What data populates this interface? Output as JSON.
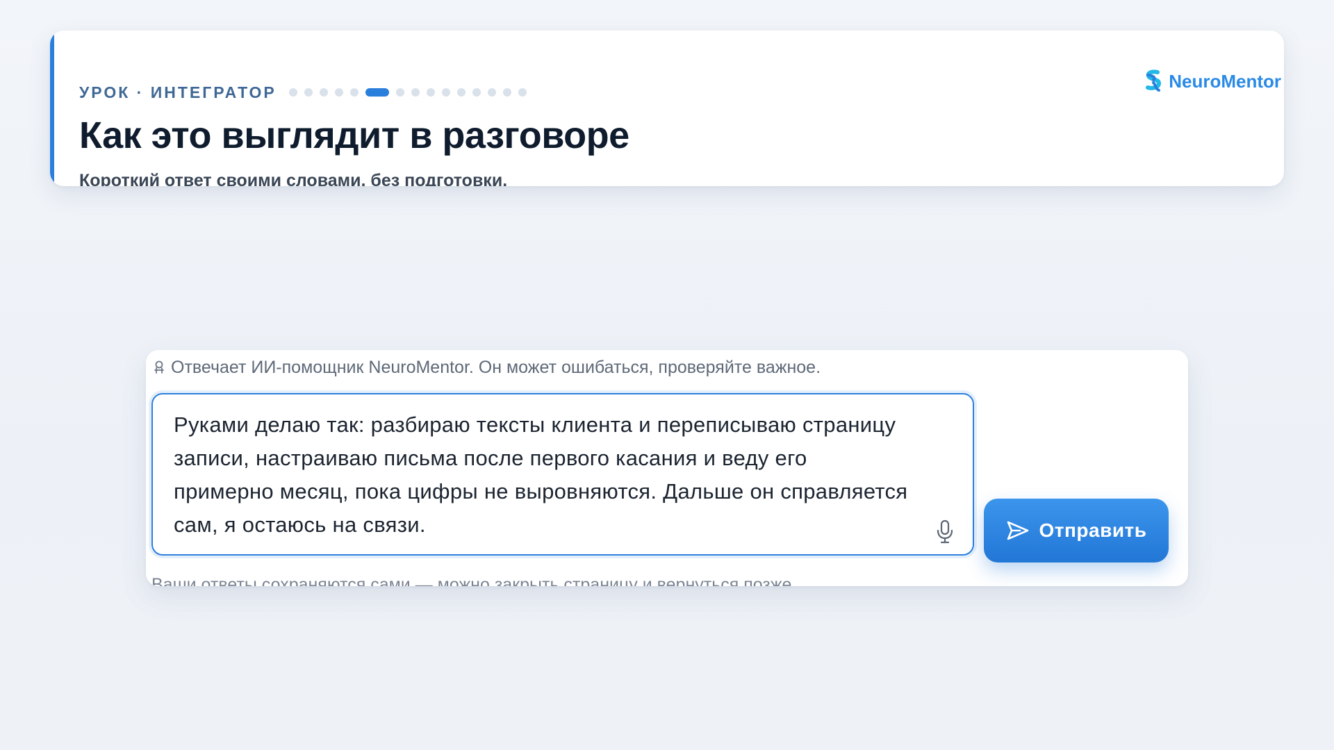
{
  "header": {
    "eyebrow": "УРОК · ИНТЕГРАТОР",
    "progress": {
      "total_steps": 15,
      "current_step": 6
    },
    "title": "Как это выглядит в разговоре",
    "subtitle": "Короткий ответ своими словами, без подготовки.",
    "brand": {
      "name": "NeuroMentor",
      "icon": "neuromentor-logo-icon",
      "color": "#2a8ae6"
    }
  },
  "composer": {
    "disclaimer_icon": "ai-assistant-icon",
    "disclaimer": "Отвечает ИИ-помощник NeuroMentor. Он может ошибаться, проверяйте важное.",
    "answer_value": "Руками делаю так: разбираю тексты клиента и переписываю страницу записи, настраиваю письма после первого касания и веду его примерно месяц, пока цифры не выровняются. Дальше он справляется сам, я остаюсь на связи.",
    "mic_icon": "microphone-icon",
    "send_icon": "send-icon",
    "send_label": "Отправить",
    "autosave_note": "Ваши ответы сохраняются сами — можно закрыть страницу и вернуться позже."
  },
  "colors": {
    "accent": "#2a7fdc",
    "title": "#0f1c2e",
    "background": "#eef2f7"
  }
}
